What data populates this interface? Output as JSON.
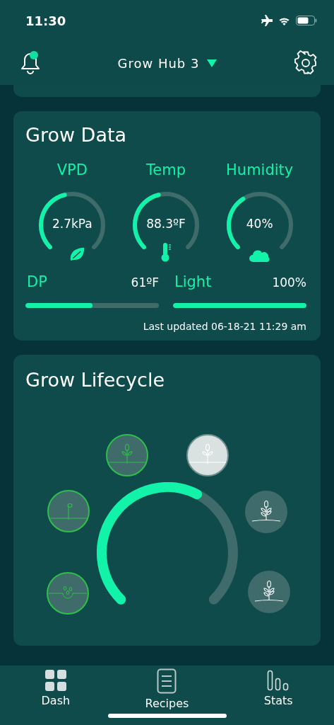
{
  "status_bar": {
    "time": "11:30"
  },
  "header": {
    "title": "Grow Hub 3",
    "notification": true
  },
  "grow_data": {
    "title": "Grow Data",
    "gauges": [
      {
        "label": "VPD",
        "value": "2.7kPa",
        "kind": "leaf"
      },
      {
        "label": "Temp",
        "value": "88.3ºF",
        "kind": "thermometer"
      },
      {
        "label": "Humidity",
        "value": "40%",
        "kind": "cloud"
      }
    ],
    "bars": [
      {
        "label": "DP",
        "value": "61ºF",
        "level": 0.5
      },
      {
        "label": "Light",
        "value": "100%",
        "level": 1
      }
    ],
    "last_updated": "Last updated 06-18-21 11:29 am"
  },
  "lifecycle": {
    "title": "Grow Lifecycle",
    "stages": [
      {
        "completed": true,
        "selected": false
      },
      {
        "completed": true,
        "selected": false
      },
      {
        "completed": true,
        "selected": false
      },
      {
        "completed": false,
        "selected": true
      },
      {
        "completed": false,
        "selected": false
      },
      {
        "completed": false,
        "selected": false
      }
    ]
  },
  "tabs": [
    {
      "label": "Dash",
      "kind": "grid"
    },
    {
      "label": "Recipes",
      "kind": "document"
    },
    {
      "label": "Stats",
      "kind": "bars"
    }
  ]
}
